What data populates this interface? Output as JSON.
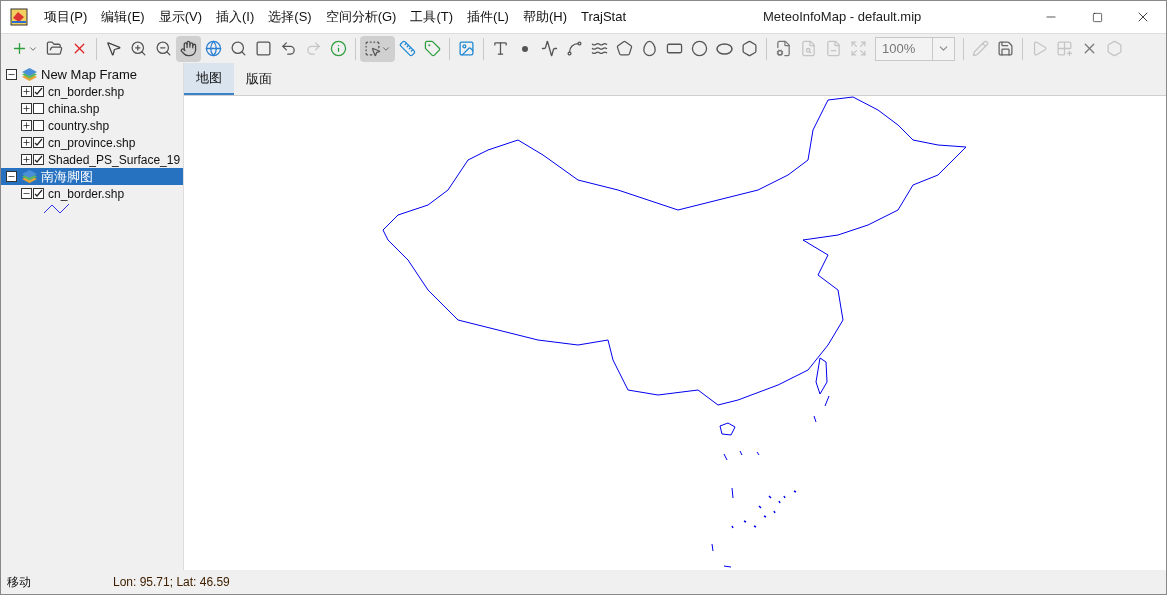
{
  "window": {
    "title": "MeteoInfoMap - default.mip"
  },
  "menu": [
    "项目(P)",
    "编辑(E)",
    "显示(V)",
    "插入(I)",
    "选择(S)",
    "空间分析(G)",
    "工具(T)",
    "插件(L)",
    "帮助(H)",
    "TrajStat"
  ],
  "toolbar": {
    "tools": [
      {
        "selected": false,
        "disabled": false
      },
      {
        "selected": false,
        "disabled": false
      },
      {
        "selected": false,
        "disabled": false
      },
      {
        "selected": false,
        "disabled": false
      },
      {
        "selected": false,
        "disabled": false
      },
      {
        "selected": false,
        "disabled": false
      },
      {
        "selected": true,
        "disabled": false
      },
      {
        "selected": false,
        "disabled": false
      },
      {
        "selected": false,
        "disabled": false
      },
      {
        "selected": false,
        "disabled": false
      },
      {
        "selected": false,
        "disabled": false
      },
      {
        "selected": false,
        "disabled": true
      },
      {
        "selected": false,
        "disabled": false
      },
      {
        "selected": true,
        "disabled": false
      },
      {
        "selected": false,
        "disabled": false
      },
      {
        "selected": false,
        "disabled": false
      },
      {
        "selected": false,
        "disabled": false
      },
      {
        "selected": false,
        "disabled": false
      },
      {
        "selected": false,
        "disabled": false
      },
      {
        "selected": false,
        "disabled": false
      },
      {
        "selected": false,
        "disabled": false
      },
      {
        "selected": false,
        "disabled": false
      },
      {
        "selected": false,
        "disabled": false
      },
      {
        "selected": false,
        "disabled": false
      },
      {
        "selected": false,
        "disabled": false
      },
      {
        "selected": false,
        "disabled": false
      },
      {
        "selected": false,
        "disabled": false
      },
      {
        "selected": false,
        "disabled": false
      },
      {
        "selected": false,
        "disabled": false
      },
      {
        "selected": false,
        "disabled": true
      },
      {
        "selected": false,
        "disabled": true
      },
      {
        "selected": false,
        "disabled": true
      }
    ],
    "zoom_value": "100%",
    "edit_tools": [
      {
        "selected": false,
        "disabled": true
      },
      {
        "selected": false,
        "disabled": false
      },
      {
        "selected": false,
        "disabled": true
      },
      {
        "selected": false,
        "disabled": true
      },
      {
        "selected": false,
        "disabled": false
      },
      {
        "selected": false,
        "disabled": true
      }
    ]
  },
  "layers": [
    {
      "label": "New Map Frame",
      "selected": false,
      "expanded": true,
      "children": [
        {
          "label": "cn_border.shp",
          "checked": true,
          "expanded": false
        },
        {
          "label": "china.shp",
          "checked": false,
          "expanded": false
        },
        {
          "label": "country.shp",
          "checked": false,
          "expanded": false
        },
        {
          "label": "cn_province.shp",
          "checked": true,
          "expanded": false
        },
        {
          "label": "Shaded_PS_Surface_19",
          "checked": true,
          "expanded": false
        }
      ]
    },
    {
      "label": "南海脚图",
      "selected": true,
      "expanded": true,
      "children": [
        {
          "label": "cn_border.shp",
          "checked": true,
          "expanded": true
        }
      ]
    }
  ],
  "tabs": [
    {
      "label": "地图",
      "selected": true
    },
    {
      "label": "版面",
      "selected": false
    }
  ],
  "status_bar": {
    "mode": "移动",
    "coordinates": "Lon: 95.71; Lat: 46.59"
  }
}
